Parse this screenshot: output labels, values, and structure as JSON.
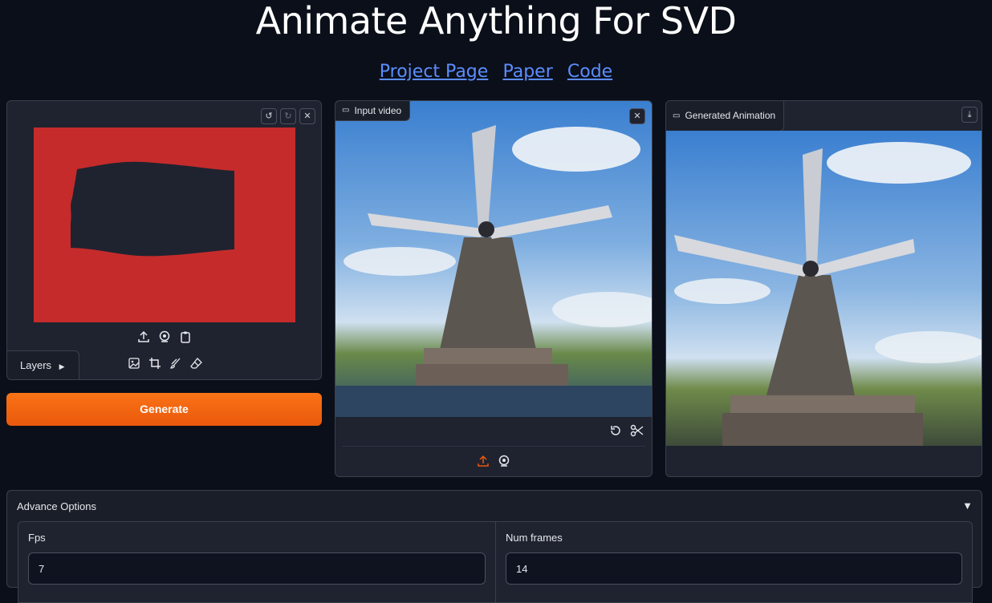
{
  "header": {
    "title": "Animate Anything For SVD",
    "links": [
      "Project Page",
      "Paper",
      "Code"
    ]
  },
  "mask_editor": {
    "layers_label": "Layers",
    "mask_color": "#c62b2b",
    "hole_color": "#1f2330"
  },
  "generate_button": {
    "label": "Generate"
  },
  "input_video": {
    "label": "Input video"
  },
  "generated": {
    "label": "Generated Animation"
  },
  "advanced": {
    "title": "Advance Options",
    "toggle_glyph": "▼",
    "fps": {
      "label": "Fps",
      "value": "7"
    },
    "num_frames": {
      "label": "Num frames",
      "value": "14"
    }
  },
  "colors": {
    "accent": "#ea580c",
    "link": "#5b8dff",
    "background": "#0b0f19"
  }
}
